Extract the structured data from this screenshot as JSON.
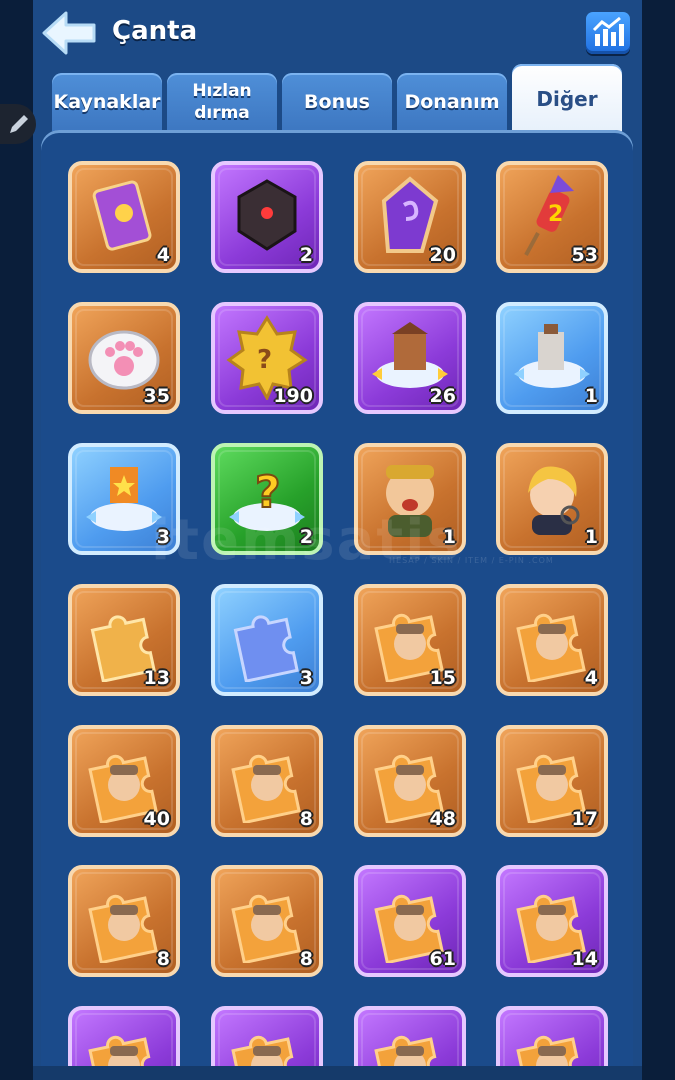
{
  "header": {
    "title": "Çanta",
    "back_icon": "arrow-left-icon",
    "stats_icon": "bar-chart-icon"
  },
  "side": {
    "edit_icon": "pencil-icon"
  },
  "tabs": [
    {
      "label": "Kaynaklar",
      "active": false
    },
    {
      "label": "Hızlan dırma",
      "active": false
    },
    {
      "label": "Bonus",
      "active": false
    },
    {
      "label": "Donanım",
      "active": false
    },
    {
      "label": "Diğer",
      "active": true
    }
  ],
  "watermark": {
    "text": "itemsatis",
    "subtext": "HESAP / SKIN / ITEM / E-PIN .COM"
  },
  "items": [
    {
      "count": "4",
      "rarity": "orange",
      "icon": "card-icon"
    },
    {
      "count": "2",
      "rarity": "purple",
      "icon": "dark-crystal-icon"
    },
    {
      "count": "20",
      "rarity": "orange",
      "icon": "purple-gem-icon"
    },
    {
      "count": "53",
      "rarity": "orange",
      "icon": "firework-rocket-icon"
    },
    {
      "count": "35",
      "rarity": "orange",
      "icon": "paw-soap-icon"
    },
    {
      "count": "190",
      "rarity": "purple",
      "icon": "mystery-badge-icon"
    },
    {
      "count": "26",
      "rarity": "purple",
      "icon": "building-move-icon"
    },
    {
      "count": "1",
      "rarity": "blue",
      "icon": "tower-move-icon"
    },
    {
      "count": "3",
      "rarity": "blue",
      "icon": "banner-move-icon"
    },
    {
      "count": "2",
      "rarity": "green",
      "icon": "question-move-icon"
    },
    {
      "count": "1",
      "rarity": "orange",
      "icon": "hero-boy-icon"
    },
    {
      "count": "1",
      "rarity": "orange",
      "icon": "hero-girl-icon"
    },
    {
      "count": "13",
      "rarity": "orange",
      "icon": "puzzle-orange-icon"
    },
    {
      "count": "3",
      "rarity": "blue",
      "icon": "puzzle-blue-icon"
    },
    {
      "count": "15",
      "rarity": "orange",
      "icon": "puzzle-hero-icon"
    },
    {
      "count": "4",
      "rarity": "orange",
      "icon": "puzzle-hero-icon"
    },
    {
      "count": "40",
      "rarity": "orange",
      "icon": "puzzle-hero-icon"
    },
    {
      "count": "8",
      "rarity": "orange",
      "icon": "puzzle-hero-icon"
    },
    {
      "count": "48",
      "rarity": "orange",
      "icon": "puzzle-hero-icon"
    },
    {
      "count": "17",
      "rarity": "orange",
      "icon": "puzzle-hero-icon"
    },
    {
      "count": "8",
      "rarity": "orange",
      "icon": "puzzle-hero-icon"
    },
    {
      "count": "8",
      "rarity": "orange",
      "icon": "puzzle-hero-icon"
    },
    {
      "count": "61",
      "rarity": "purple",
      "icon": "puzzle-hero-icon"
    },
    {
      "count": "14",
      "rarity": "purple",
      "icon": "puzzle-hero-icon"
    },
    {
      "count": "",
      "rarity": "purple",
      "icon": "puzzle-hero-icon"
    },
    {
      "count": "",
      "rarity": "purple",
      "icon": "puzzle-hero-icon"
    },
    {
      "count": "",
      "rarity": "purple",
      "icon": "puzzle-hero-icon"
    },
    {
      "count": "",
      "rarity": "purple",
      "icon": "puzzle-hero-icon"
    }
  ],
  "colors": {
    "orange": "#d4803a",
    "purple": "#9a45e3",
    "blue": "#5aa7f2",
    "green": "#2fae32"
  }
}
